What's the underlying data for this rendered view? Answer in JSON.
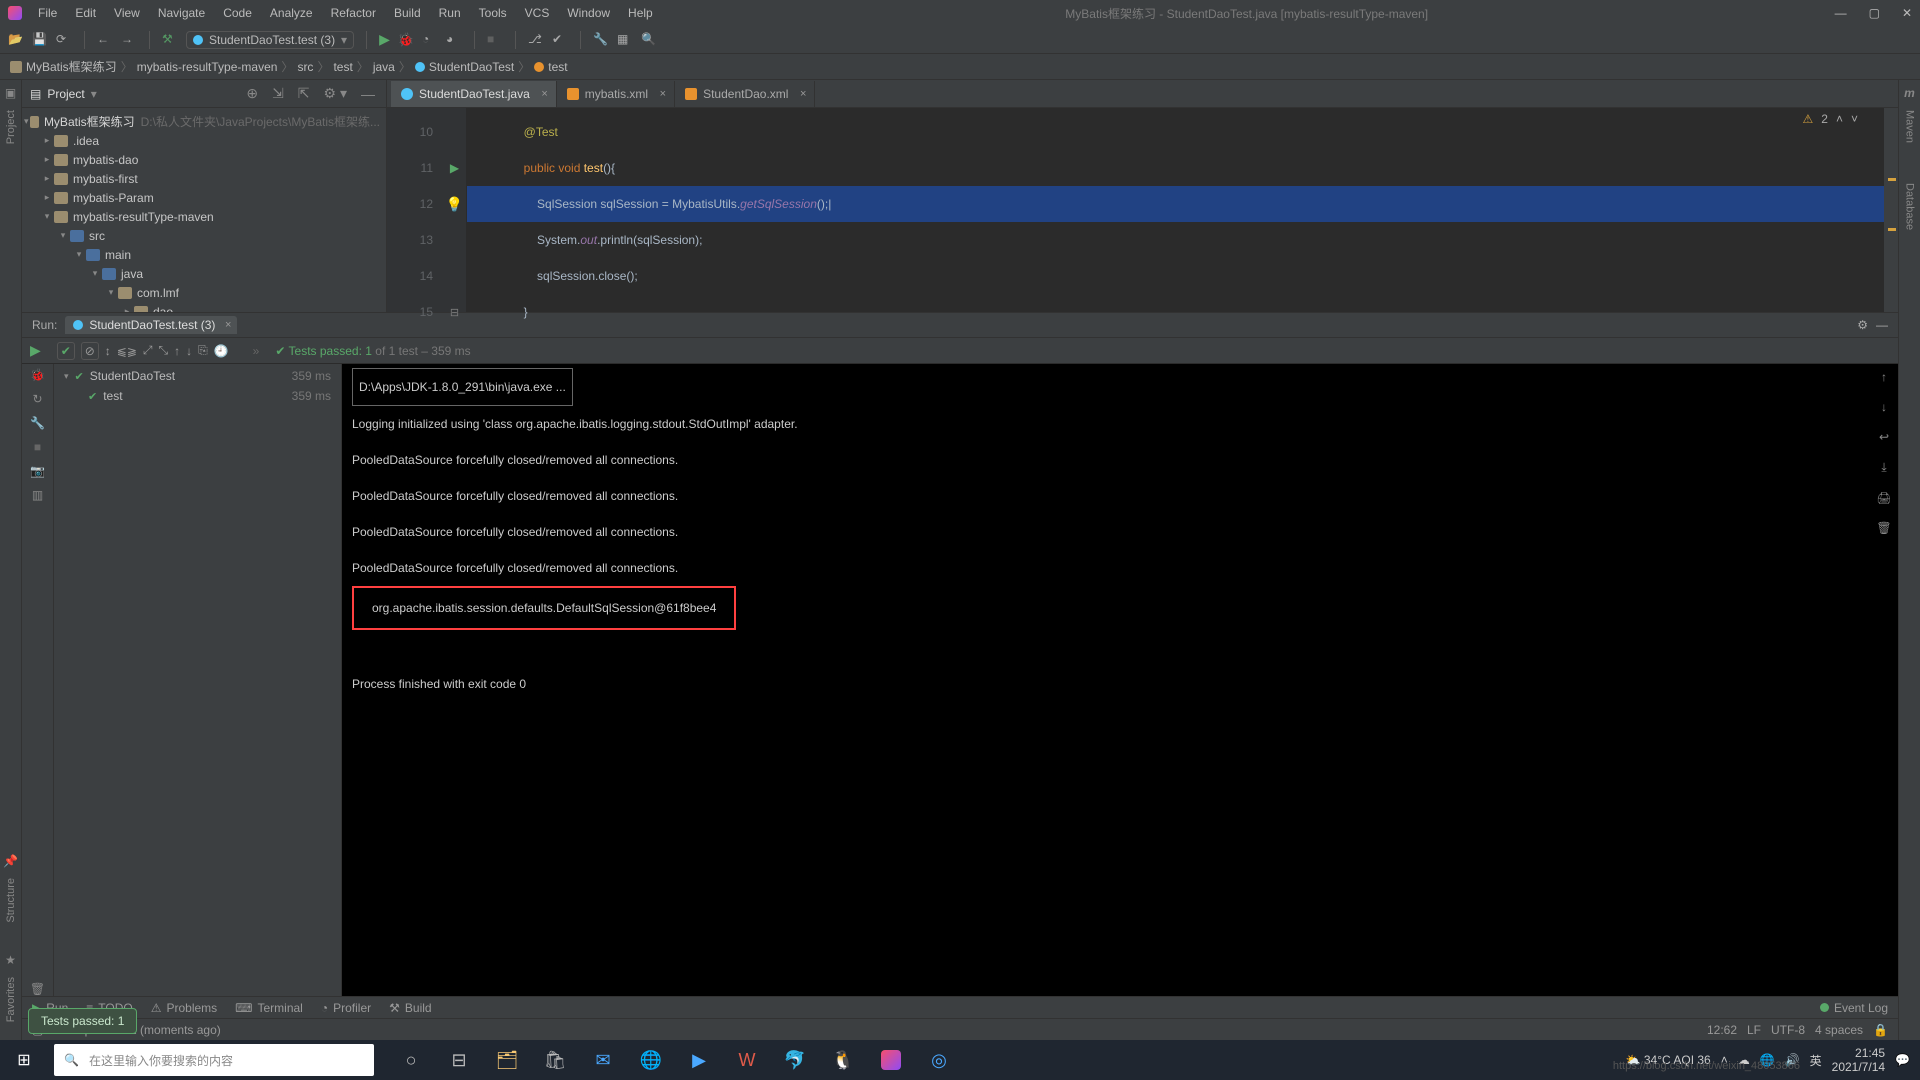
{
  "title": "MyBatis框架练习 - StudentDaoTest.java [mybatis-resultType-maven]",
  "menus": [
    "File",
    "Edit",
    "View",
    "Navigate",
    "Code",
    "Analyze",
    "Refactor",
    "Build",
    "Run",
    "Tools",
    "VCS",
    "Window",
    "Help"
  ],
  "run_config": "StudentDaoTest.test (3)",
  "breadcrumb": [
    "MyBatis框架练习",
    "mybatis-resultType-maven",
    "src",
    "test",
    "java",
    "StudentDaoTest",
    "test"
  ],
  "project_panel_title": "Project",
  "project_tree": {
    "root_name": "MyBatis框架练习",
    "root_path": "D:\\私人文件夹\\JavaProjects\\MyBatis框架练...",
    "children": [
      {
        "name": ".idea",
        "indent": 1,
        "open": false
      },
      {
        "name": "mybatis-dao",
        "indent": 1,
        "open": false
      },
      {
        "name": "mybatis-first",
        "indent": 1,
        "open": false
      },
      {
        "name": "mybatis-Param",
        "indent": 1,
        "open": false
      },
      {
        "name": "mybatis-resultType-maven",
        "indent": 1,
        "open": true
      },
      {
        "name": "src",
        "indent": 2,
        "open": true,
        "src": true
      },
      {
        "name": "main",
        "indent": 3,
        "open": true,
        "src": true
      },
      {
        "name": "java",
        "indent": 4,
        "open": true,
        "src": true
      },
      {
        "name": "com.lmf",
        "indent": 5,
        "open": true
      },
      {
        "name": "dao",
        "indent": 6,
        "open": false
      }
    ]
  },
  "editor_tabs": [
    {
      "name": "StudentDaoTest.java",
      "active": true,
      "icon": "class"
    },
    {
      "name": "mybatis.xml",
      "active": false,
      "icon": "xml"
    },
    {
      "name": "StudentDao.xml",
      "active": false,
      "icon": "xml"
    }
  ],
  "problems_count": "2",
  "code": {
    "lines": [
      {
        "n": 10,
        "html": "        <span class='an'>@Test</span>",
        "markers": []
      },
      {
        "n": 11,
        "html": "        <span class='kw'>public void</span> <span class='mth'>test</span><span class='punc'>(){</span>",
        "markers": [
          "run",
          "fold"
        ]
      },
      {
        "n": 12,
        "html": "            <span class='id'>SqlSession sqlSession</span> <span class='punc'>=</span> <span class='id'>MybatisUtils</span><span class='punc'>.</span><span class='static'>getSqlSession</span><span class='punc'>();</span><span class='id'>|</span>",
        "sel": true,
        "markers": [
          "bulb"
        ]
      },
      {
        "n": 13,
        "html": "            <span class='id'>System</span><span class='punc'>.</span><span class='field'>out</span><span class='punc'>.println(</span><span class='id'>sqlSession</span><span class='punc'>);</span>",
        "markers": []
      },
      {
        "n": 14,
        "html": "            <span class='id'>sqlSession</span><span class='punc'>.close();</span>",
        "markers": []
      },
      {
        "n": 15,
        "html": "        <span class='punc'>}</span>",
        "markers": [
          "fold"
        ]
      }
    ]
  },
  "run_panel_title": "Run:",
  "run_panel_tab": "StudentDaoTest.test (3)",
  "tests_passed_summary": {
    "prefix": "Tests passed:",
    "count": "1",
    "of": " of 1 test – 359 ms"
  },
  "test_tree": [
    {
      "name": "StudentDaoTest",
      "time": "359 ms",
      "child": false
    },
    {
      "name": "test",
      "time": "359 ms",
      "child": true
    }
  ],
  "console": {
    "cmd": "D:\\Apps\\JDK-1.8.0_291\\bin\\java.exe ...",
    "lines": [
      "Logging initialized using 'class org.apache.ibatis.logging.stdout.StdOutImpl' adapter.",
      "PooledDataSource forcefully closed/removed all connections.",
      "PooledDataSource forcefully closed/removed all connections.",
      "PooledDataSource forcefully closed/removed all connections.",
      "PooledDataSource forcefully closed/removed all connections."
    ],
    "highlighted": "org.apache.ibatis.session.defaults.DefaultSqlSession@61f8bee4",
    "exit": "Process finished with exit code 0"
  },
  "toast": "Tests passed: 1",
  "left_rail": [
    "Project",
    "Structure",
    "Favorites"
  ],
  "right_rail_label": "Maven",
  "tool_strip": {
    "items": [
      "Run",
      "TODO",
      "Problems",
      "Terminal",
      "Profiler",
      "Build"
    ],
    "event_log": "Event Log"
  },
  "statusbar": {
    "msg": "Tests passed: 1 (moments ago)",
    "pos": "12:62",
    "sep": "LF",
    "enc": "UTF-8",
    "indent": "4 spaces"
  },
  "taskbar": {
    "search_placeholder": "在这里输入你要搜索的内容",
    "weather": "34°C  AQI 36",
    "time": "21:45",
    "date": "2021/7/14",
    "watermark": "https://blog.csdn.net/weixin_48053866"
  }
}
